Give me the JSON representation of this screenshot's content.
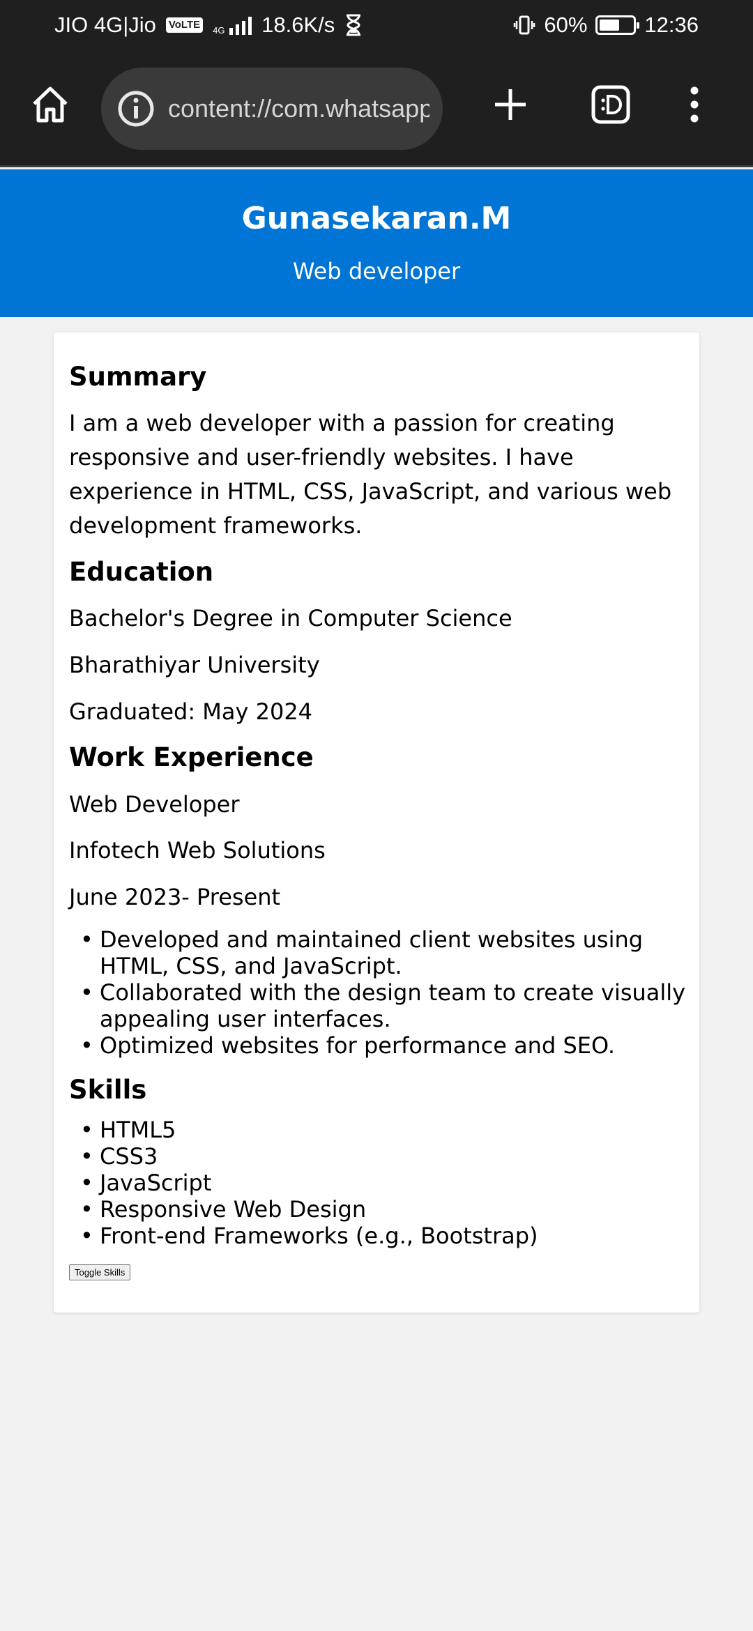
{
  "status_bar": {
    "carrier": "JIO 4G|Jio",
    "volte": "VoLTE",
    "network": "4G",
    "speed": "18.6K/s",
    "battery": "60%",
    "battery_level": 0.6,
    "time": "12:36"
  },
  "browser": {
    "url": "content://com.whatsapp"
  },
  "header": {
    "name": "Gunasekaran.M",
    "title": "Web developer"
  },
  "summary": {
    "heading": "Summary",
    "text": "I am a web developer with a passion for creating responsive and user-friendly websites. I have experience in HTML, CSS, JavaScript, and various web development frameworks."
  },
  "education": {
    "heading": "Education",
    "degree": "Bachelor's Degree in Computer Science",
    "university": "Bharathiyar University",
    "graduated": "Graduated: May 2024"
  },
  "work": {
    "heading": "Work Experience",
    "role": "Web Developer",
    "company": "Infotech Web Solutions",
    "period": "June 2023- Present",
    "items": [
      "Developed and maintained client websites using HTML, CSS, and JavaScript.",
      "Collaborated with the design team to create visually appealing user interfaces.",
      "Optimized websites for performance and SEO."
    ]
  },
  "skills": {
    "heading": "Skills",
    "items": [
      "HTML5",
      "CSS3",
      "JavaScript",
      "Responsive Web Design",
      "Front-end Frameworks (e.g., Bootstrap)"
    ],
    "toggle_label": "Toggle Skills"
  }
}
